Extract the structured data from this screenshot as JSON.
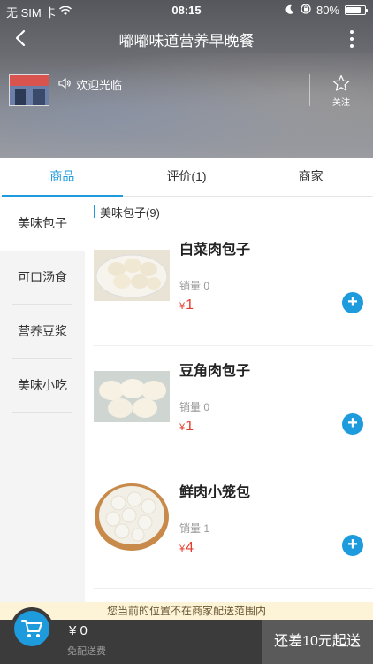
{
  "status_bar": {
    "carrier": "无 SIM 卡",
    "time": "08:15",
    "battery": "80%",
    "battery_level": 0.8
  },
  "nav": {
    "title": "嘟嘟味道营养早晚餐"
  },
  "store": {
    "welcome": "欢迎光临",
    "follow_label": "关注"
  },
  "tabs": [
    {
      "label": "商品",
      "active": true
    },
    {
      "label": "评价(1)",
      "active": false
    },
    {
      "label": "商家",
      "active": false
    }
  ],
  "categories": [
    {
      "label": "美味包子",
      "active": true
    },
    {
      "label": "可口汤食",
      "active": false
    },
    {
      "label": "营养豆浆",
      "active": false
    },
    {
      "label": "美味小吃",
      "active": false
    }
  ],
  "section": {
    "title": "美味包子(9)"
  },
  "products": [
    {
      "name": "白菜肉包子",
      "sales": "销量 0",
      "currency": "¥",
      "price": "1"
    },
    {
      "name": "豆角肉包子",
      "sales": "销量 0",
      "currency": "¥",
      "price": "1"
    },
    {
      "name": "鲜肉小笼包",
      "sales": "销量 1",
      "currency": "¥",
      "price": "4"
    }
  ],
  "notice": "您当前的位置不在商家配送范围内",
  "cart": {
    "total": "¥ 0",
    "delivery": "免配送费",
    "checkout_label": "还差10元起送"
  },
  "colors": {
    "accent": "#1e9bdc",
    "price": "#e43b2c",
    "notice_bg": "#fdf3d6",
    "bottom_bar": "#3b3b3b"
  },
  "icons": {
    "back": "back-arrow-icon",
    "more": "more-dots-icon",
    "speaker": "speaker-icon",
    "star": "star-icon",
    "cart": "cart-icon",
    "add": "plus-icon",
    "wifi": "wifi-icon",
    "lock": "rotation-lock-icon"
  }
}
